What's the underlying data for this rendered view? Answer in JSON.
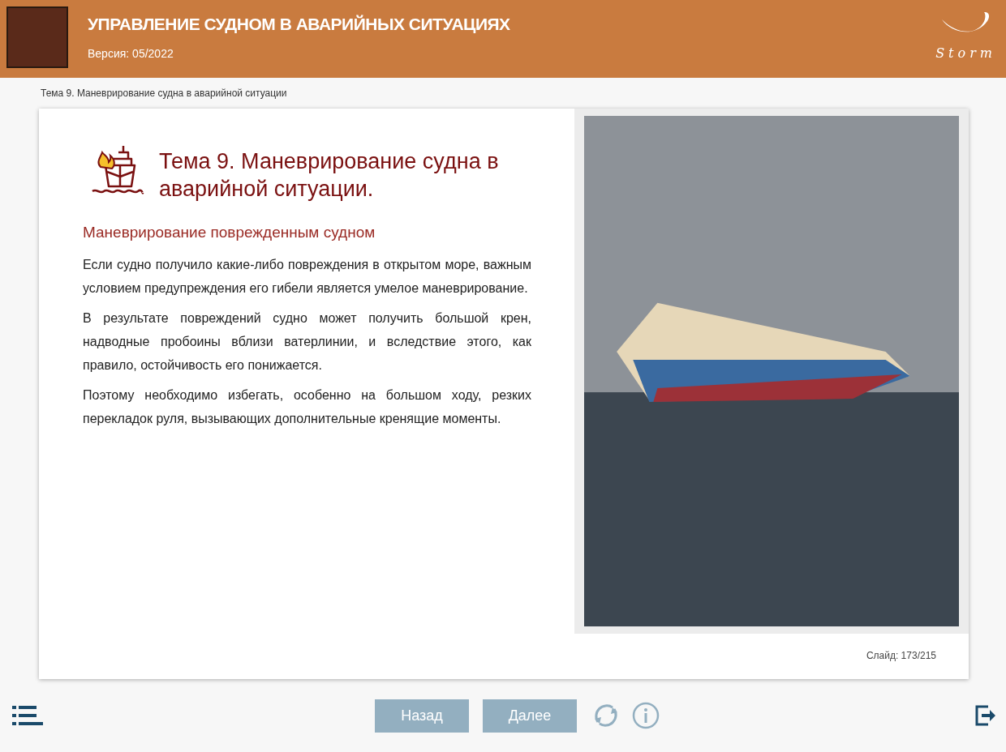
{
  "header": {
    "title": "УПРАВЛЕНИЕ СУДНОМ В АВАРИЙНЫХ СИТУАЦИЯХ",
    "version": "Версия: 05/2022",
    "logo_text": "Storm"
  },
  "breadcrumb": "Тема 9. Маневрирование судна в аварийной ситуации",
  "slide": {
    "title": "Тема 9. Маневрирование судна в аварийной ситуации.",
    "subtitle": "Маневрирование поврежденным судном",
    "paragraphs": [
      "Если судно получило какие-либо повреждения в открытом море, важным условием предупреждения его гибели является умелое маневрирование.",
      "В результате повреждений судно может получить большой крен, надводные пробоины вблизи ватерлинии, и вследствие этого, как правило, остойчивость его понижается.",
      "Поэтому необходимо избегать, особенно на большом ходу, резких перекладок руля, вызывающих дополнительные кренящие моменты."
    ],
    "counter": "Слайд: 173/215"
  },
  "footer": {
    "buttons": [
      {
        "label": "Назад"
      },
      {
        "label": "Далее"
      }
    ]
  }
}
